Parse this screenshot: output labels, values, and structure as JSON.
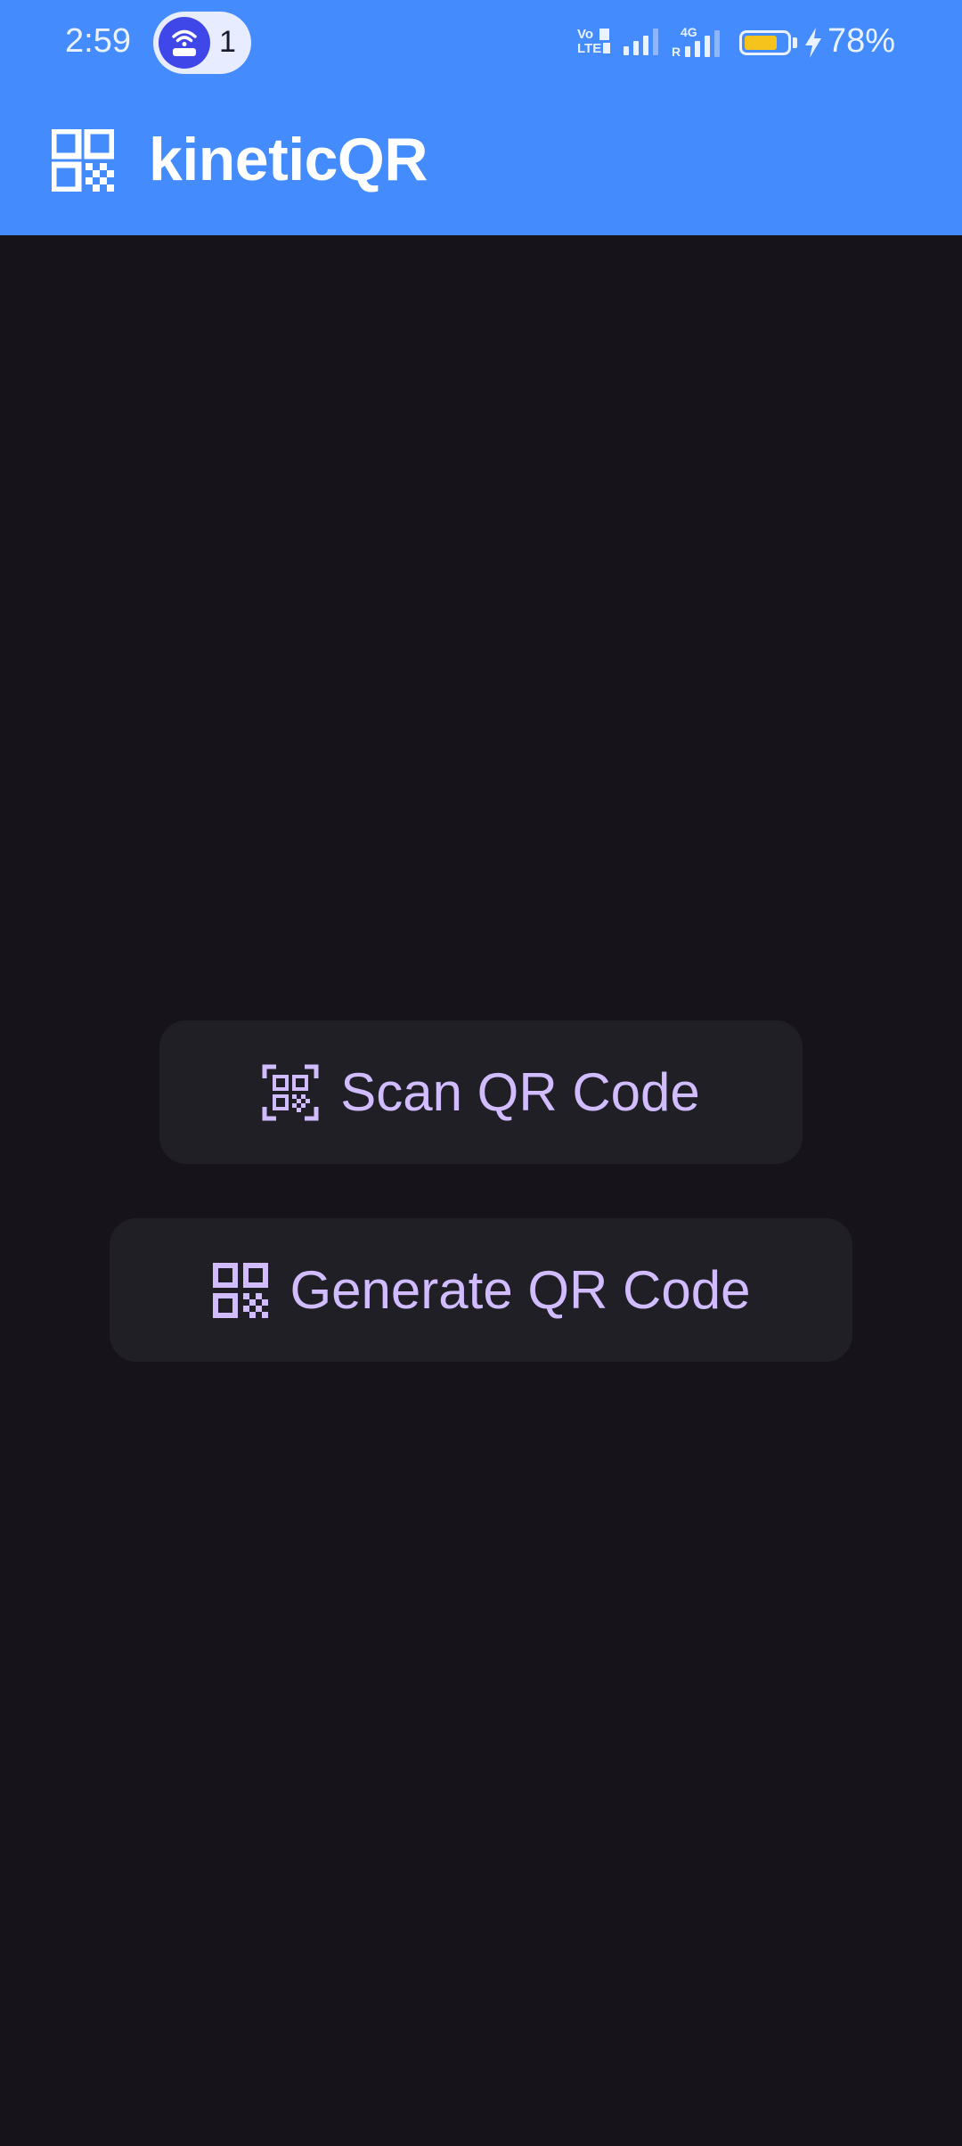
{
  "status_bar": {
    "time": "2:59",
    "hotspot_count": "1",
    "volte_label": "Vo LTE",
    "battery_percent": "78%",
    "battery_level": 0.78,
    "battery_color": "#f6c21c",
    "icons": [
      "wifi-hotspot-icon",
      "signal-bars-icon",
      "signal-4g-icon",
      "battery-icon",
      "charging-bolt-icon"
    ]
  },
  "app_bar": {
    "title": "kineticQR",
    "logo_icon": "qr-code-icon",
    "background": "#448cfd"
  },
  "main": {
    "background": "#16131a",
    "scan_button_label": "Scan QR Code",
    "generate_button_label": "Generate QR Code",
    "button_text_color": "#d0bcff",
    "button_background": "#211f26"
  }
}
